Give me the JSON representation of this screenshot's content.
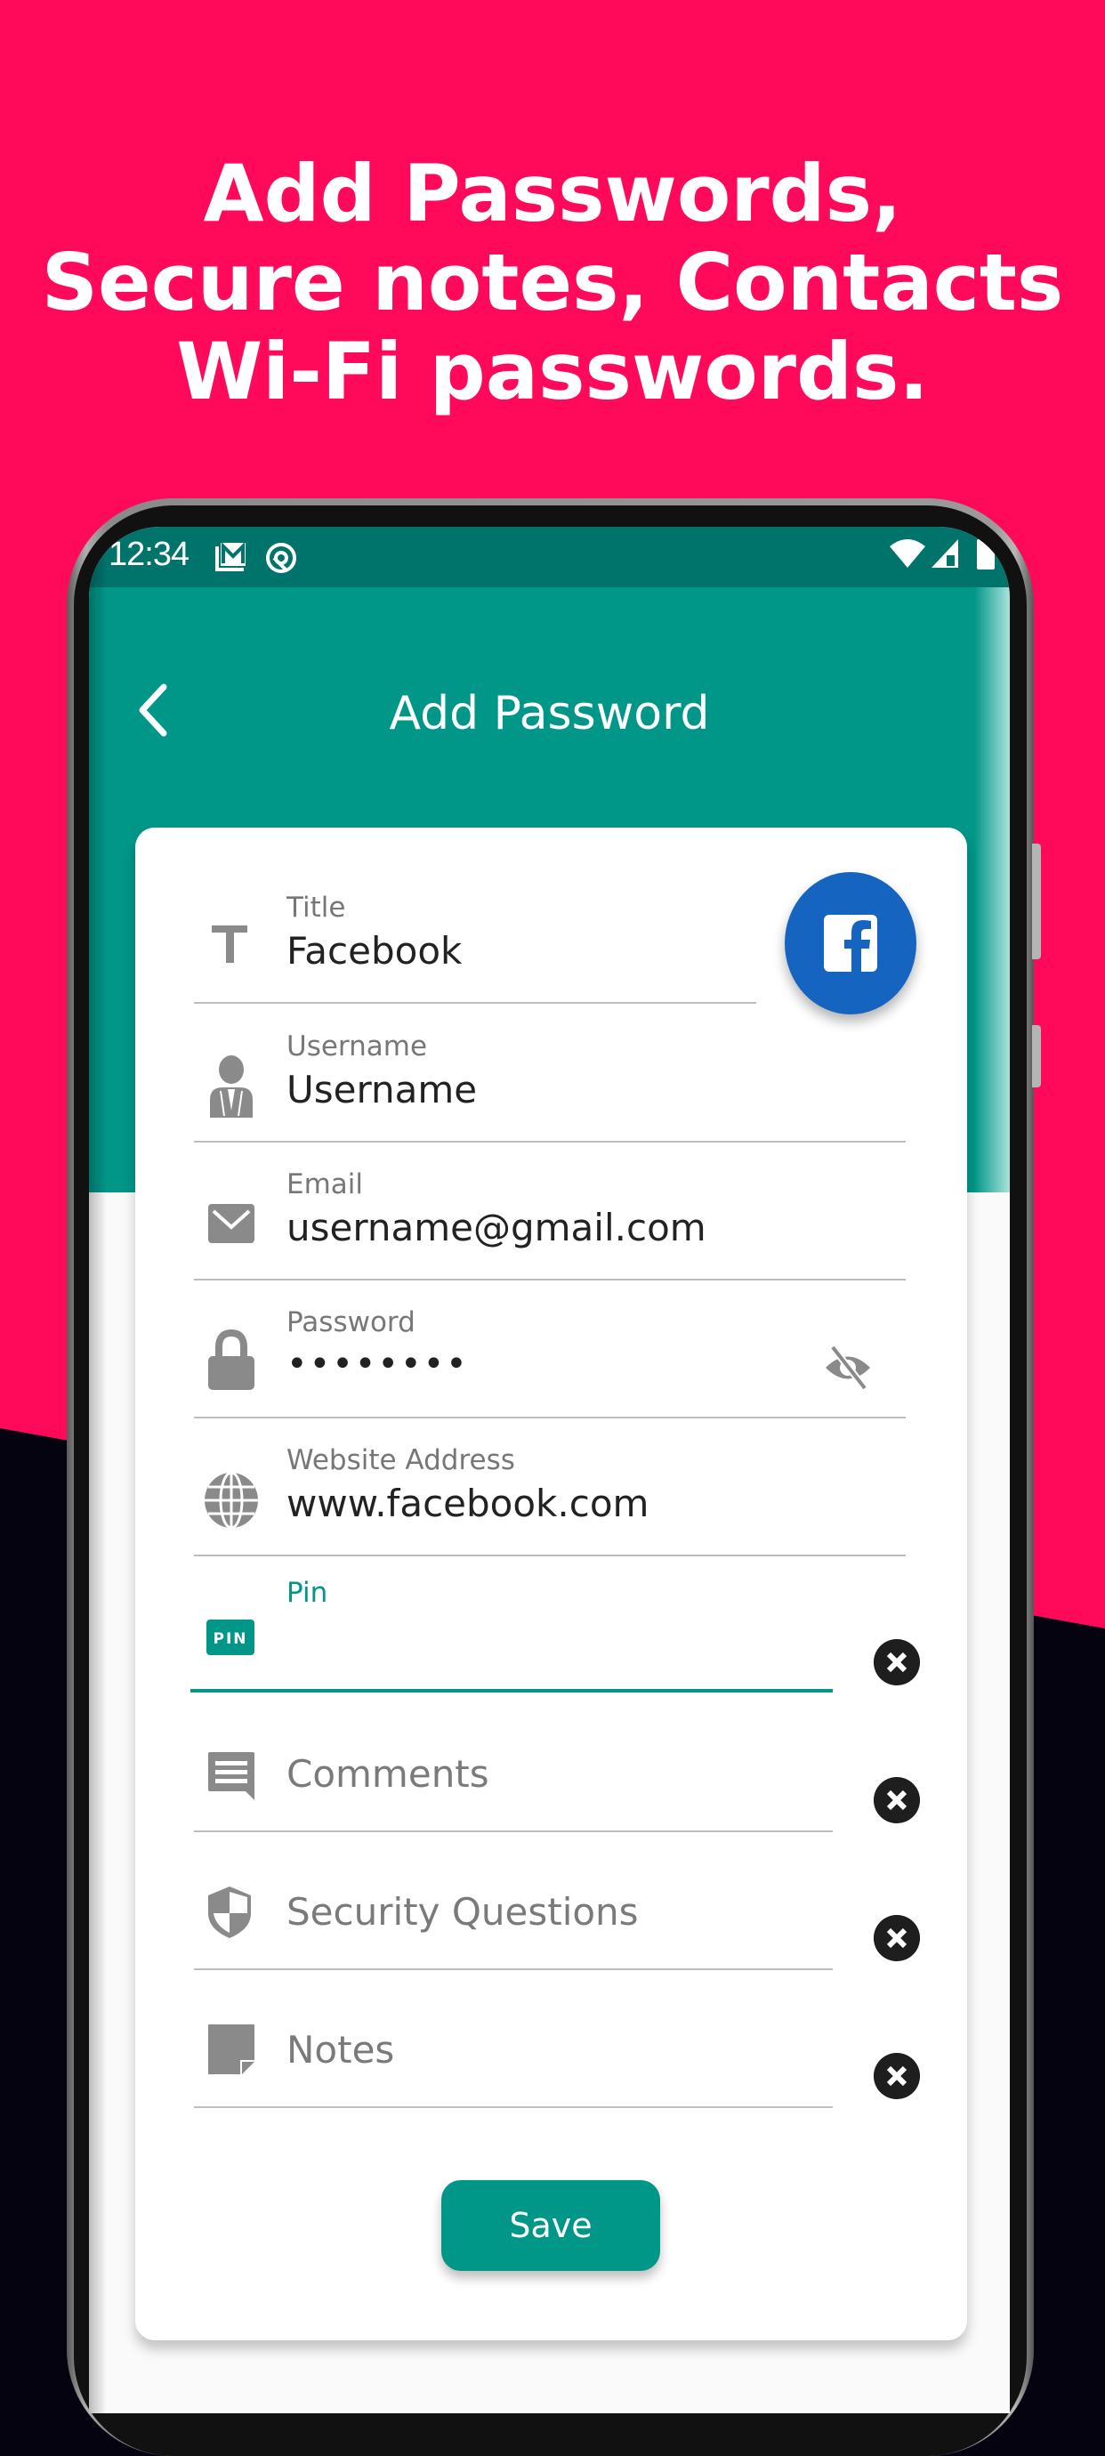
{
  "promo": {
    "headline_lines": [
      "Add Passwords,",
      "Secure notes, Contacts",
      "Wi-Fi passwords."
    ],
    "colors": {
      "background_top": "#ff0a5a",
      "background_bottom": "#05030f"
    }
  },
  "status_bar": {
    "time": "12:34",
    "left_icons": [
      "gmail-notification-icon",
      "at-sign-notification-icon"
    ],
    "right_icons": [
      "wifi-icon",
      "cellular-signal-icon",
      "battery-icon"
    ]
  },
  "app_bar": {
    "title": "Add Password",
    "back_icon": "chevron-left-icon",
    "color": "#009688",
    "status_color": "#00736a"
  },
  "form": {
    "category_button": {
      "icon": "facebook-icon",
      "color": "#1565c0"
    },
    "fields": [
      {
        "id": "title",
        "icon": "text-t-icon",
        "label": "Title",
        "value": "Facebook"
      },
      {
        "id": "username",
        "icon": "user-icon",
        "label": "Username",
        "value": "Username"
      },
      {
        "id": "email",
        "icon": "email-icon",
        "label": "Email",
        "value": "username@gmail.com"
      },
      {
        "id": "password",
        "icon": "lock-icon",
        "label": "Password",
        "value": "••••••••",
        "trailing_icon": "eye-off-icon"
      },
      {
        "id": "website",
        "icon": "globe-icon",
        "label": "Website Address",
        "value": "www.facebook.com"
      },
      {
        "id": "pin",
        "icon": "pin-icon",
        "icon_text": "PIN",
        "label": "Pin",
        "value": "",
        "focused": true,
        "trailing_icon": "clear-icon"
      },
      {
        "id": "comments",
        "icon": "comment-icon",
        "placeholder": "Comments",
        "trailing_icon": "clear-icon"
      },
      {
        "id": "security_questions",
        "icon": "shield-icon",
        "placeholder": "Security Questions",
        "trailing_icon": "clear-icon"
      },
      {
        "id": "notes",
        "icon": "note-icon",
        "placeholder": "Notes",
        "trailing_icon": "clear-icon"
      }
    ],
    "save_label": "Save"
  }
}
